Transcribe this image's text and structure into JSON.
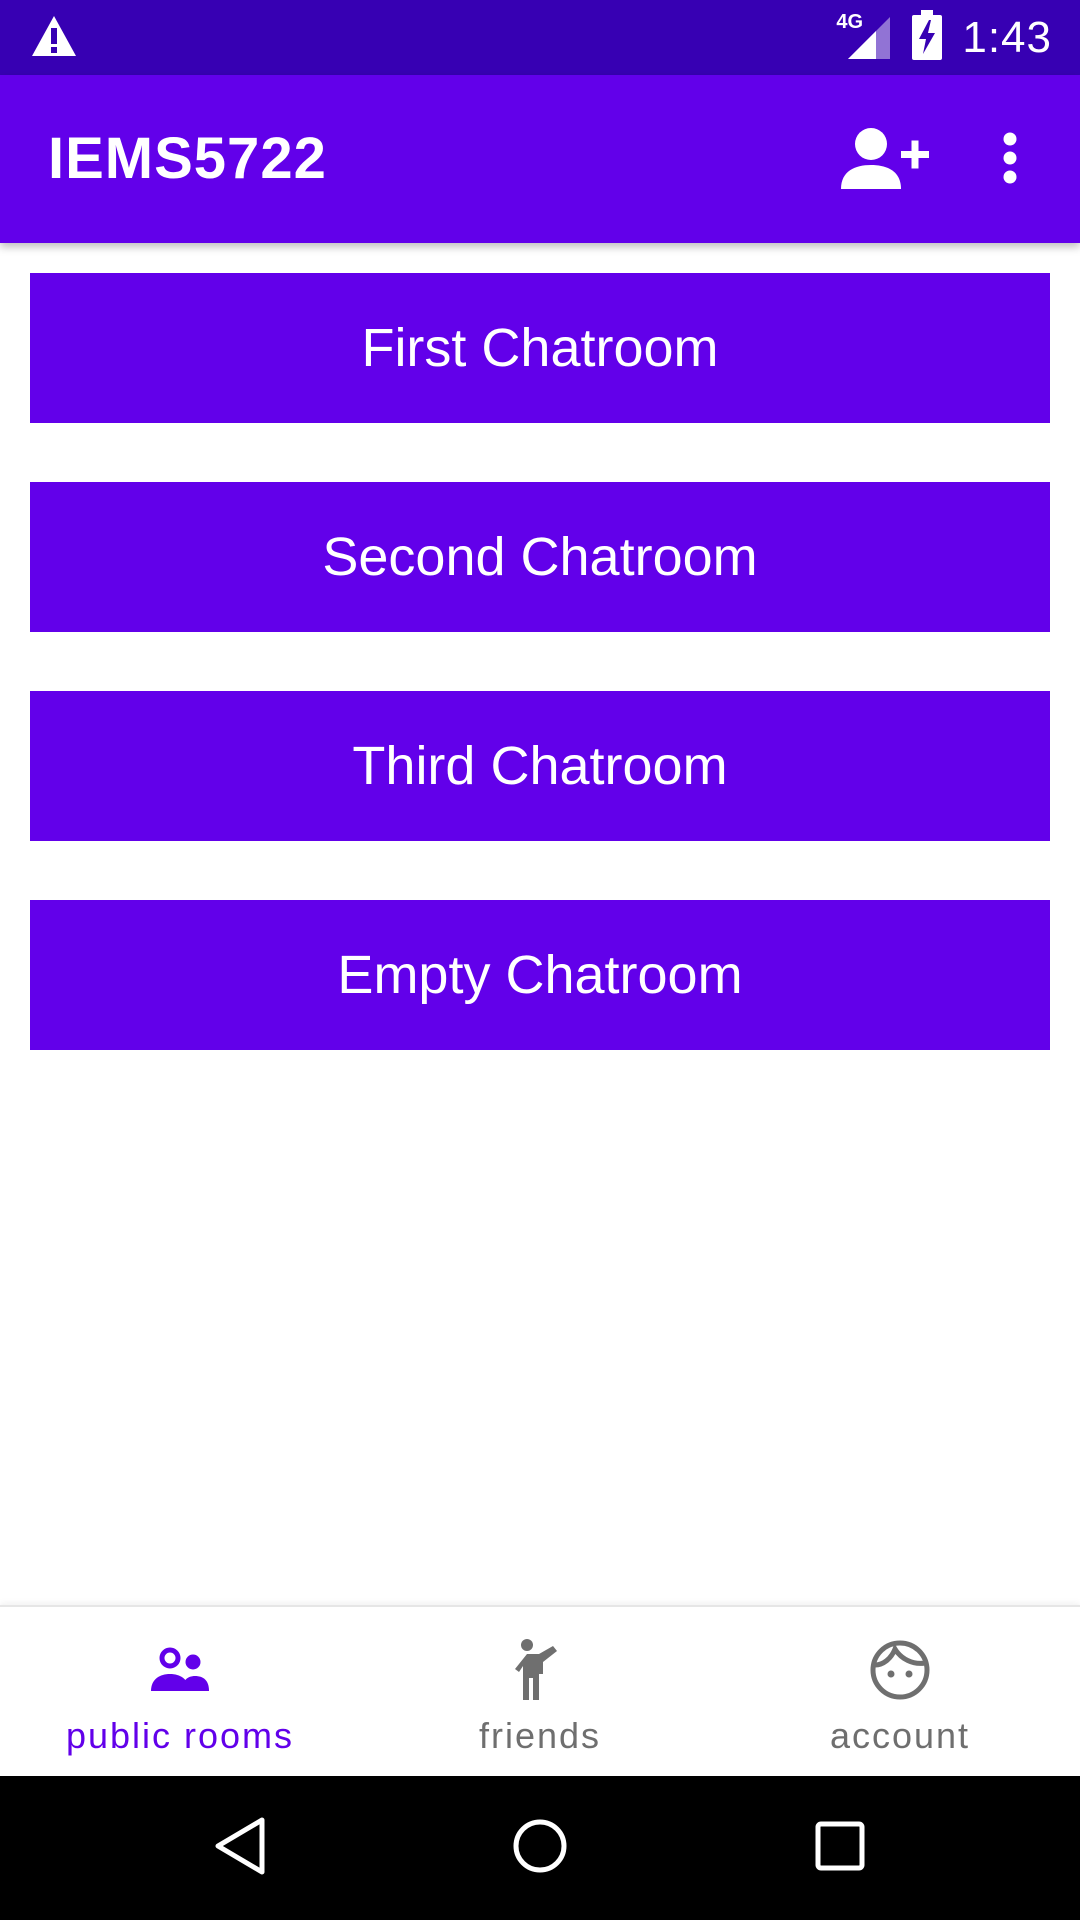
{
  "status_bar": {
    "time": "1:43",
    "network": "4G",
    "icons": [
      "warning-icon",
      "signal-icon",
      "battery-charging-icon"
    ]
  },
  "app_bar": {
    "title": "IEMS5722",
    "actions": [
      "add-person-icon",
      "more-vert-icon"
    ]
  },
  "rooms": [
    {
      "label": "First Chatroom"
    },
    {
      "label": "Second Chatroom"
    },
    {
      "label": "Third Chatroom"
    },
    {
      "label": "Empty Chatroom"
    }
  ],
  "bottom_nav": {
    "items": [
      {
        "label": "public rooms",
        "icon": "group-icon",
        "active": true
      },
      {
        "label": "friends",
        "icon": "person-waving-icon",
        "active": false
      },
      {
        "label": "account",
        "icon": "face-icon",
        "active": false
      }
    ]
  },
  "system_nav": {
    "icons": [
      "back-icon",
      "home-icon",
      "recents-icon"
    ]
  },
  "colors": {
    "primary": "#6200ea",
    "primary_dark": "#3700b3",
    "inactive": "#6f6f6f"
  }
}
